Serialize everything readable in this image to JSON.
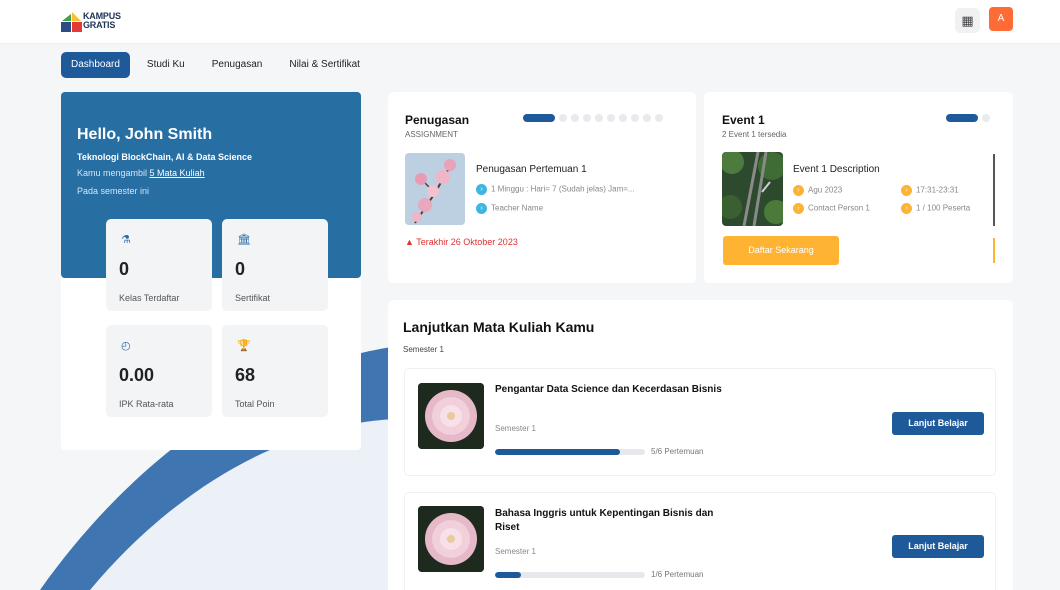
{
  "brand": {
    "line1": "KAMPUS",
    "line2": "GRATIS"
  },
  "header": {
    "grid_icon": "grid-icon",
    "avatar_initial": "A"
  },
  "tabs": [
    {
      "label": "Dashboard"
    },
    {
      "label": "Studi Ku"
    },
    {
      "label": "Penugasan"
    },
    {
      "label": "Nilai & Sertifikat"
    }
  ],
  "hello": {
    "greeting": "Hello, John Smith",
    "program": "Teknologi BlockChain, AI & Data Science",
    "taking_prefix": "Kamu mengambil",
    "taking_link": "5 Mata Kuliah",
    "semester_note": "Pada semester ini"
  },
  "stats": [
    {
      "icon": "flask-icon",
      "value": "0",
      "label": "Kelas Terdaftar"
    },
    {
      "icon": "building-icon",
      "value": "0",
      "label": "Sertifikat"
    },
    {
      "icon": "clock-icon",
      "value": "0.00",
      "label": "IPK Rata-rata"
    },
    {
      "icon": "trophy-icon",
      "value": "68",
      "label": "Total Poin"
    }
  ],
  "assignment": {
    "title": "Penugasan",
    "subtitle": "ASSIGNMENT",
    "item_title": "Penugasan Pertemuan 1",
    "duration": "1 Minggu : Hari= 7 (Sudah jelas) Jam=...",
    "teacher": "Teacher Name",
    "deadline": "Terakhir 26 Oktober 2023"
  },
  "event": {
    "title": "Event 1",
    "subtitle": "2 Event 1 tersedia",
    "item_title": "Event 1 Description",
    "date": "Agu 2023",
    "time": "17:31-23:31",
    "contact": "Contact Person 1",
    "participants": "1 / 100 Peserta",
    "button": "Daftar Sekarang"
  },
  "continue": {
    "title": "Lanjutkan Mata Kuliah Kamu",
    "semester": "Semester 1"
  },
  "courses": [
    {
      "title": "Pengantar Data Science dan Kecerdasan Bisnis",
      "semester": "Semester 1",
      "progress_label": "5/6 Pertemuan",
      "progress": 0.83,
      "button": "Lanjut Belajar"
    },
    {
      "title": "Bahasa Inggris untuk Kepentingan Bisnis dan Riset",
      "semester": "Semester 1",
      "progress_label": "1/6 Pertemuan",
      "progress": 0.17,
      "button": "Lanjut Belajar"
    }
  ],
  "colors": {
    "primary": "#1e5a9a",
    "hello_bg": "#276ea3",
    "accent_orange": "#ffb332",
    "deadline_red": "#e03030",
    "avatar_bg": "#ff6b35"
  }
}
